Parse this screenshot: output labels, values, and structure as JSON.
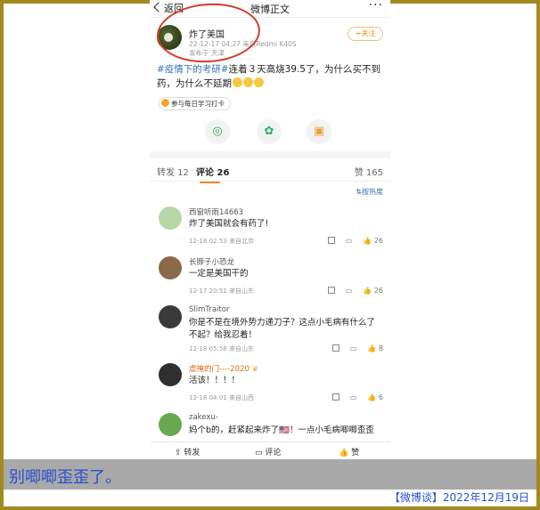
{
  "topbar": {
    "back_label": "返回",
    "title": "微博正文",
    "more": "···"
  },
  "post": {
    "author": "炸了美国",
    "time_device": "22-12-17 04:27  来自Redmi K40S",
    "location": "发布于 天津",
    "follow_label": "+关注",
    "tags": "#疫情下的考研#",
    "text": "连着３天高烧39.5了，为什么买不到药，为什么不延期",
    "study_chip": "参与每日学习打卡"
  },
  "tabs": {
    "repost": "转发 12",
    "comments": "评论 26",
    "likes": "赞 165",
    "sort": "按热度"
  },
  "comments": [
    {
      "name": "西窗听雨14663",
      "text": "炸了美国就会有药了!",
      "meta": "12-18 02:53  来自北京",
      "likes": "26",
      "avatar_color": "#b6d7a8"
    },
    {
      "name": "长脖子小恐龙",
      "text": "一定是美国干的",
      "meta": "12-17 20:51  来自山东",
      "likes": "26",
      "avatar_color": "#8a6a4a"
    },
    {
      "name": "SlimTraitor",
      "text": "你是不是在境外势力递刀子？这点小毛病有什么了不起？给我忍着！",
      "meta": "12-18 05:58  来自山东",
      "likes": "8",
      "avatar_color": "#3a3a3a"
    },
    {
      "name": "虐掩的门----2020",
      "text": "活该！！！！",
      "meta": "12-18 04:01  来自山西",
      "likes": "6",
      "avatar_color": "#2f2f2f"
    },
    {
      "name": "zakexu-",
      "text": "妈个b的，赶紧起来炸了🇺🇸！一点小毛病唧唧歪歪",
      "meta": "",
      "likes": "",
      "avatar_color": "#6aa84f"
    }
  ],
  "bottombar": {
    "repost": "转发",
    "comment": "评论",
    "like": "赞"
  },
  "caption": "别唧唧歪歪了。",
  "source": "【微博谈】2022年12月19日",
  "colors": {
    "frame": "#a38a20",
    "caption_bg": "#a9a9a9",
    "caption_text": "#2a4fcf",
    "circle": "#d63a2a",
    "accent": "#f08a24"
  }
}
